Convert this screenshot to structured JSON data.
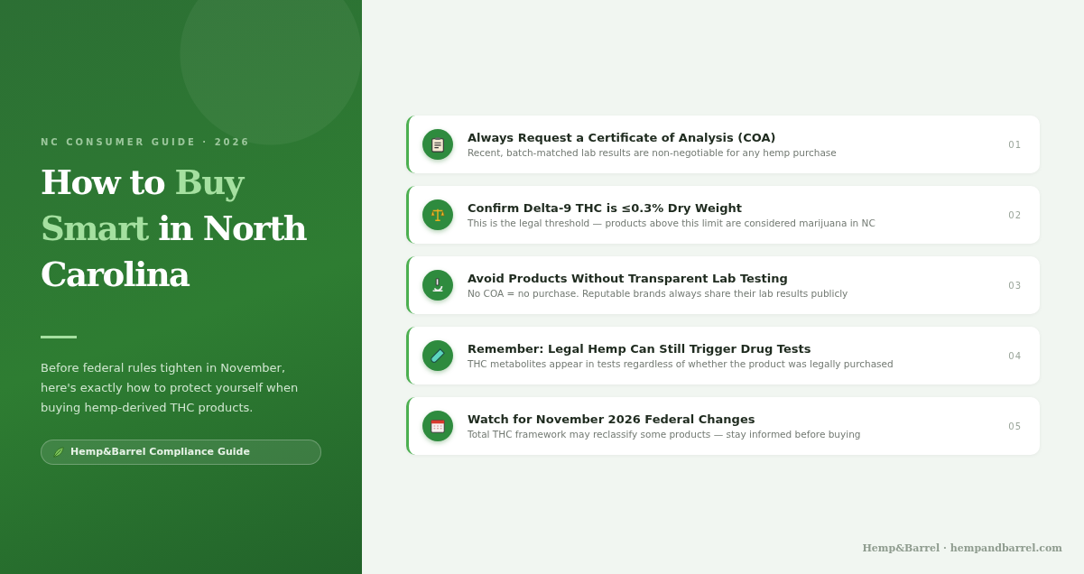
{
  "hero": {
    "eyebrow": "NC CONSUMER GUIDE · 2026",
    "title": [
      {
        "text": "How to ",
        "highlight": false
      },
      {
        "text": "Buy Smart",
        "highlight": true
      },
      {
        "text": " in North Carolina",
        "highlight": false
      }
    ],
    "intro": "Before federal rules tighten in November, here's exactly how to protect yourself when buying hemp-derived THC products.",
    "badge": "Hemp&Barrel Compliance Guide"
  },
  "tips": [
    {
      "kind": "clipboard",
      "title": "Always Request a Certificate of Analysis (COA)",
      "text": "Recent, batch-matched lab results are non-negotiable for any hemp purchase",
      "number": "01"
    },
    {
      "kind": "scales",
      "title": "Confirm Delta-9 THC is ≤0.3% Dry Weight",
      "text": "This is the legal threshold — products above this limit are considered marijuana in NC",
      "number": "02"
    },
    {
      "kind": "microscope",
      "title": "Avoid Products Without Transparent Lab Testing",
      "text": "No COA = no purchase. Reputable brands always share their lab results publicly",
      "number": "03"
    },
    {
      "kind": "test-tube",
      "title": "Remember: Legal Hemp Can Still Trigger Drug Tests",
      "text": "THC metabolites appear in tests regardless of whether the product was legally purchased",
      "number": "04"
    },
    {
      "kind": "calendar",
      "title": "Watch for November 2026 Federal Changes",
      "text": "Total THC framework may reclassify some products — stay informed before buying",
      "number": "05"
    }
  ],
  "footer": "Hemp&Barrel · hempandbarrel.com"
}
